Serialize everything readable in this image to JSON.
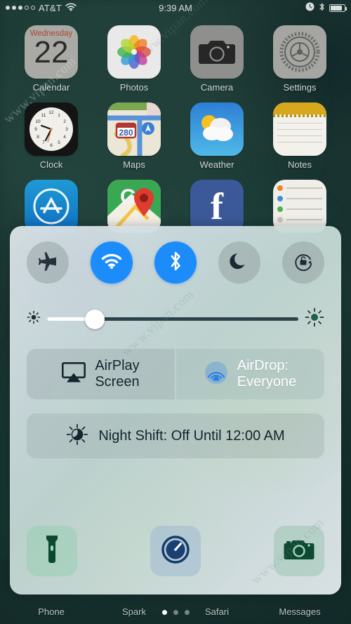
{
  "status_bar": {
    "signal_dots_total": 5,
    "signal_dots_filled": 3,
    "carrier": "AT&T",
    "wifi_icon": "wifi-icon",
    "time": "9:39 AM",
    "alarm_icon": "alarm-clock-icon",
    "bluetooth_icon": "bluetooth-icon",
    "battery_icon": "battery-icon",
    "battery_level_pct": 82
  },
  "home_screen": {
    "rows": [
      [
        {
          "label": "Calendar",
          "icon": "calendar-icon",
          "day_of_week": "Wednesday",
          "day_number": "22"
        },
        {
          "label": "Photos",
          "icon": "photos-icon"
        },
        {
          "label": "Camera",
          "icon": "camera-icon"
        },
        {
          "label": "Settings",
          "icon": "settings-icon"
        }
      ],
      [
        {
          "label": "Clock",
          "icon": "clock-icon"
        },
        {
          "label": "Maps",
          "icon": "maps-icon",
          "route_shield": "280"
        },
        {
          "label": "Weather",
          "icon": "weather-icon"
        },
        {
          "label": "Notes",
          "icon": "notes-icon"
        }
      ],
      [
        {
          "label": "",
          "icon": "app-store-icon"
        },
        {
          "label": "",
          "icon": "google-maps-icon"
        },
        {
          "label": "",
          "icon": "facebook-icon",
          "glyph": "f"
        },
        {
          "label": "",
          "icon": "reminders-icon"
        }
      ]
    ]
  },
  "dock": {
    "items": [
      {
        "label": "Phone",
        "icon": "phone-icon"
      },
      {
        "label": "Spark",
        "icon": "spark-icon"
      },
      {
        "label": "Safari",
        "icon": "safari-icon"
      },
      {
        "label": "Messages",
        "icon": "messages-icon"
      }
    ],
    "page_dots_total": 3,
    "page_dots_active_index": 0
  },
  "control_center": {
    "toggles": [
      {
        "name": "airplane-mode",
        "icon": "airplane-icon",
        "state": "off"
      },
      {
        "name": "wifi",
        "icon": "wifi-icon",
        "state": "on"
      },
      {
        "name": "bluetooth",
        "icon": "bluetooth-icon",
        "state": "on"
      },
      {
        "name": "do-not-disturb",
        "icon": "moon-icon",
        "state": "off"
      },
      {
        "name": "rotation-lock",
        "icon": "rotation-lock-icon",
        "state": "off"
      }
    ],
    "brightness": {
      "low_icon": "brightness-low-icon",
      "high_icon": "brightness-high-icon",
      "value_pct": 19
    },
    "airplay": {
      "icon": "airplay-icon",
      "line1": "AirPlay",
      "line2": "Screen"
    },
    "airdrop": {
      "icon": "airdrop-icon",
      "line1": "AirDrop:",
      "line2": "Everyone"
    },
    "night_shift": {
      "icon": "night-shift-icon",
      "label": "Night Shift: Off Until 12:00 AM"
    },
    "shortcuts": [
      {
        "name": "flashlight",
        "icon": "flashlight-icon"
      },
      {
        "name": "timer",
        "icon": "timer-icon"
      },
      {
        "name": "camera",
        "icon": "camera-icon"
      }
    ]
  },
  "colors": {
    "toggle_on": "#1b8cfa",
    "toggle_off": "rgba(140,152,152,.45)",
    "airdrop_icon": "#2a7fe8",
    "calendar_dow": "#b04433",
    "text_dark": "#16262e",
    "text_light": "#ffffff"
  },
  "watermarks": [
    "www.vipan.com",
    "www.vipan.com",
    "www.vipan.com",
    "www.vipan.com"
  ]
}
